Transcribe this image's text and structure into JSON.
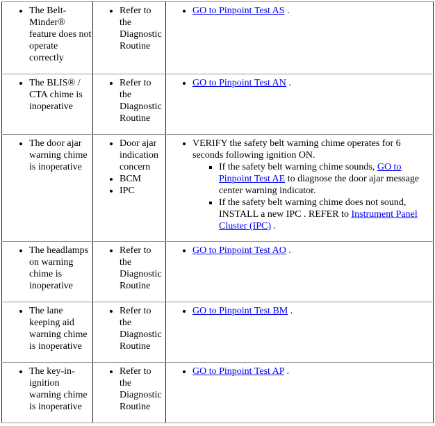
{
  "rows": [
    {
      "symptom": "The Belt-Minder® feature does not operate correctly",
      "causes": [
        "Refer to the Diagnostic Routine"
      ],
      "link": "GO to Pinpoint Test AS",
      "after": " ."
    },
    {
      "symptom": "The BLIS® / CTA chime is inoperative",
      "causes": [
        "Refer to the Diagnostic Routine"
      ],
      "link": "GO to Pinpoint Test AN",
      "after": " ."
    },
    {
      "symptom": "The door ajar warning chime is inoperative",
      "causes": [
        "Door ajar indication concern",
        "BCM",
        "IPC"
      ],
      "verify": "VERIFY the safety belt warning chime operates for 6 seconds following ignition ON.",
      "sub1_pre": "If the safety belt warning chime sounds, ",
      "sub1_link": "GO to Pinpoint Test AE",
      "sub1_post": " to diagnose the door ajar message center warning indicator.",
      "sub2_pre": "If the safety belt warning chime does not sound, INSTALL a new IPC . REFER to ",
      "sub2_link": "Instrument Panel Cluster (IPC)",
      "sub2_post": " ."
    },
    {
      "symptom": "The headlamps on warning chime is inoperative",
      "causes": [
        "Refer to the Diagnostic Routine"
      ],
      "link": "GO to Pinpoint Test AO",
      "after": " ."
    },
    {
      "symptom": "The lane keeping aid warning chime is inoperative",
      "causes": [
        "Refer to the Diagnostic Routine"
      ],
      "link": "GO to Pinpoint Test BM",
      "after": " ."
    },
    {
      "symptom": "The key-in-ignition warning chime is inoperative",
      "causes": [
        "Refer to the Diagnostic Routine"
      ],
      "link": "GO to Pinpoint Test AP",
      "after": " ."
    }
  ],
  "colors": {
    "link": "#0000ee",
    "border": "#222222"
  }
}
